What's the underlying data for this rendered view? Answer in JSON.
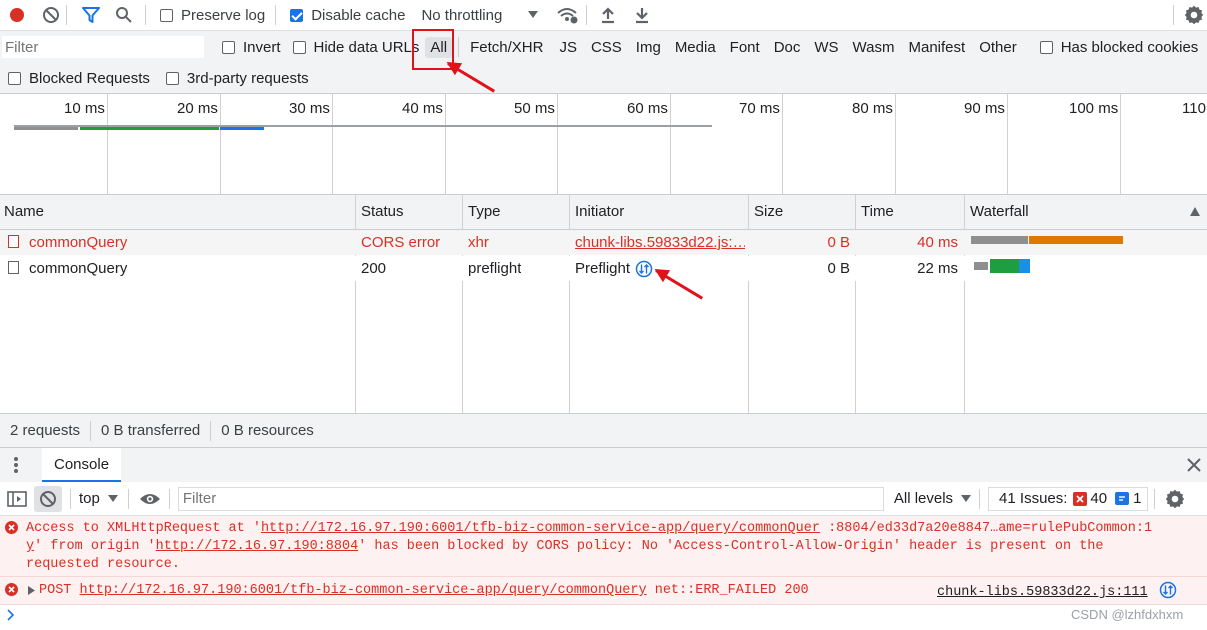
{
  "toolbar": {
    "preserve_log": "Preserve log",
    "disable_cache": "Disable cache",
    "throttling": "No throttling"
  },
  "filterbar": {
    "placeholder": "Filter",
    "invert": "Invert",
    "hide_data_urls": "Hide data URLs",
    "types": [
      "All",
      "Fetch/XHR",
      "JS",
      "CSS",
      "Img",
      "Media",
      "Font",
      "Doc",
      "WS",
      "Wasm",
      "Manifest",
      "Other"
    ],
    "has_blocked_cookies": "Has blocked cookies",
    "blocked_requests": "Blocked Requests",
    "third_party": "3rd-party requests"
  },
  "timeline": {
    "ticks": [
      "10 ms",
      "20 ms",
      "30 ms",
      "40 ms",
      "50 ms",
      "60 ms",
      "70 ms",
      "80 ms",
      "90 ms",
      "100 ms",
      "110"
    ]
  },
  "table": {
    "headers": [
      "Name",
      "Status",
      "Type",
      "Initiator",
      "Size",
      "Time",
      "Waterfall"
    ],
    "rows": [
      {
        "name": "commonQuery",
        "status": "CORS error",
        "type": "xhr",
        "initiator": "chunk-libs.59833d22.js:…",
        "size": "0 B",
        "time": "40 ms"
      },
      {
        "name": "commonQuery",
        "status": "200",
        "type": "preflight",
        "initiator": "Preflight",
        "size": "0 B",
        "time": "22 ms"
      }
    ]
  },
  "summary": {
    "requests": "2 requests",
    "transferred": "0 B transferred",
    "resources": "0 B resources"
  },
  "drawer": {
    "tab": "Console"
  },
  "console_toolbar": {
    "context": "top",
    "filter_placeholder": "Filter",
    "levels": "All levels",
    "issues_label": "41 Issues:",
    "issues_errors": "40",
    "issues_info": "1"
  },
  "console": {
    "msg1": {
      "prefix": "Access to XMLHttpRequest at '",
      "url1": "http://172.16.97.190:6001/tfb-biz-common-service-app/query/commonQuer",
      "url1_tail": ":8804/ed33d7a20e8847…ame=rulePubCommon:1",
      "url1_end": "y",
      "mid": "' from origin '",
      "url2": "http://172.16.97.190:8804",
      "rest": "' has been blocked by CORS policy: No 'Access-Control-Allow-Origin' header is present on the",
      "line3": "requested resource."
    },
    "msg2": {
      "method": "POST",
      "url": "http://172.16.97.190:6001/tfb-biz-common-service-app/query/commonQuery",
      "status": "net::ERR_FAILED 200",
      "source": "chunk-libs.59833d22.js:111"
    }
  },
  "watermark": "CSDN @lzhfdxhxm",
  "colors": {
    "error": "#d93025",
    "accent": "#1a73e8",
    "annotation": "#e0121a"
  }
}
